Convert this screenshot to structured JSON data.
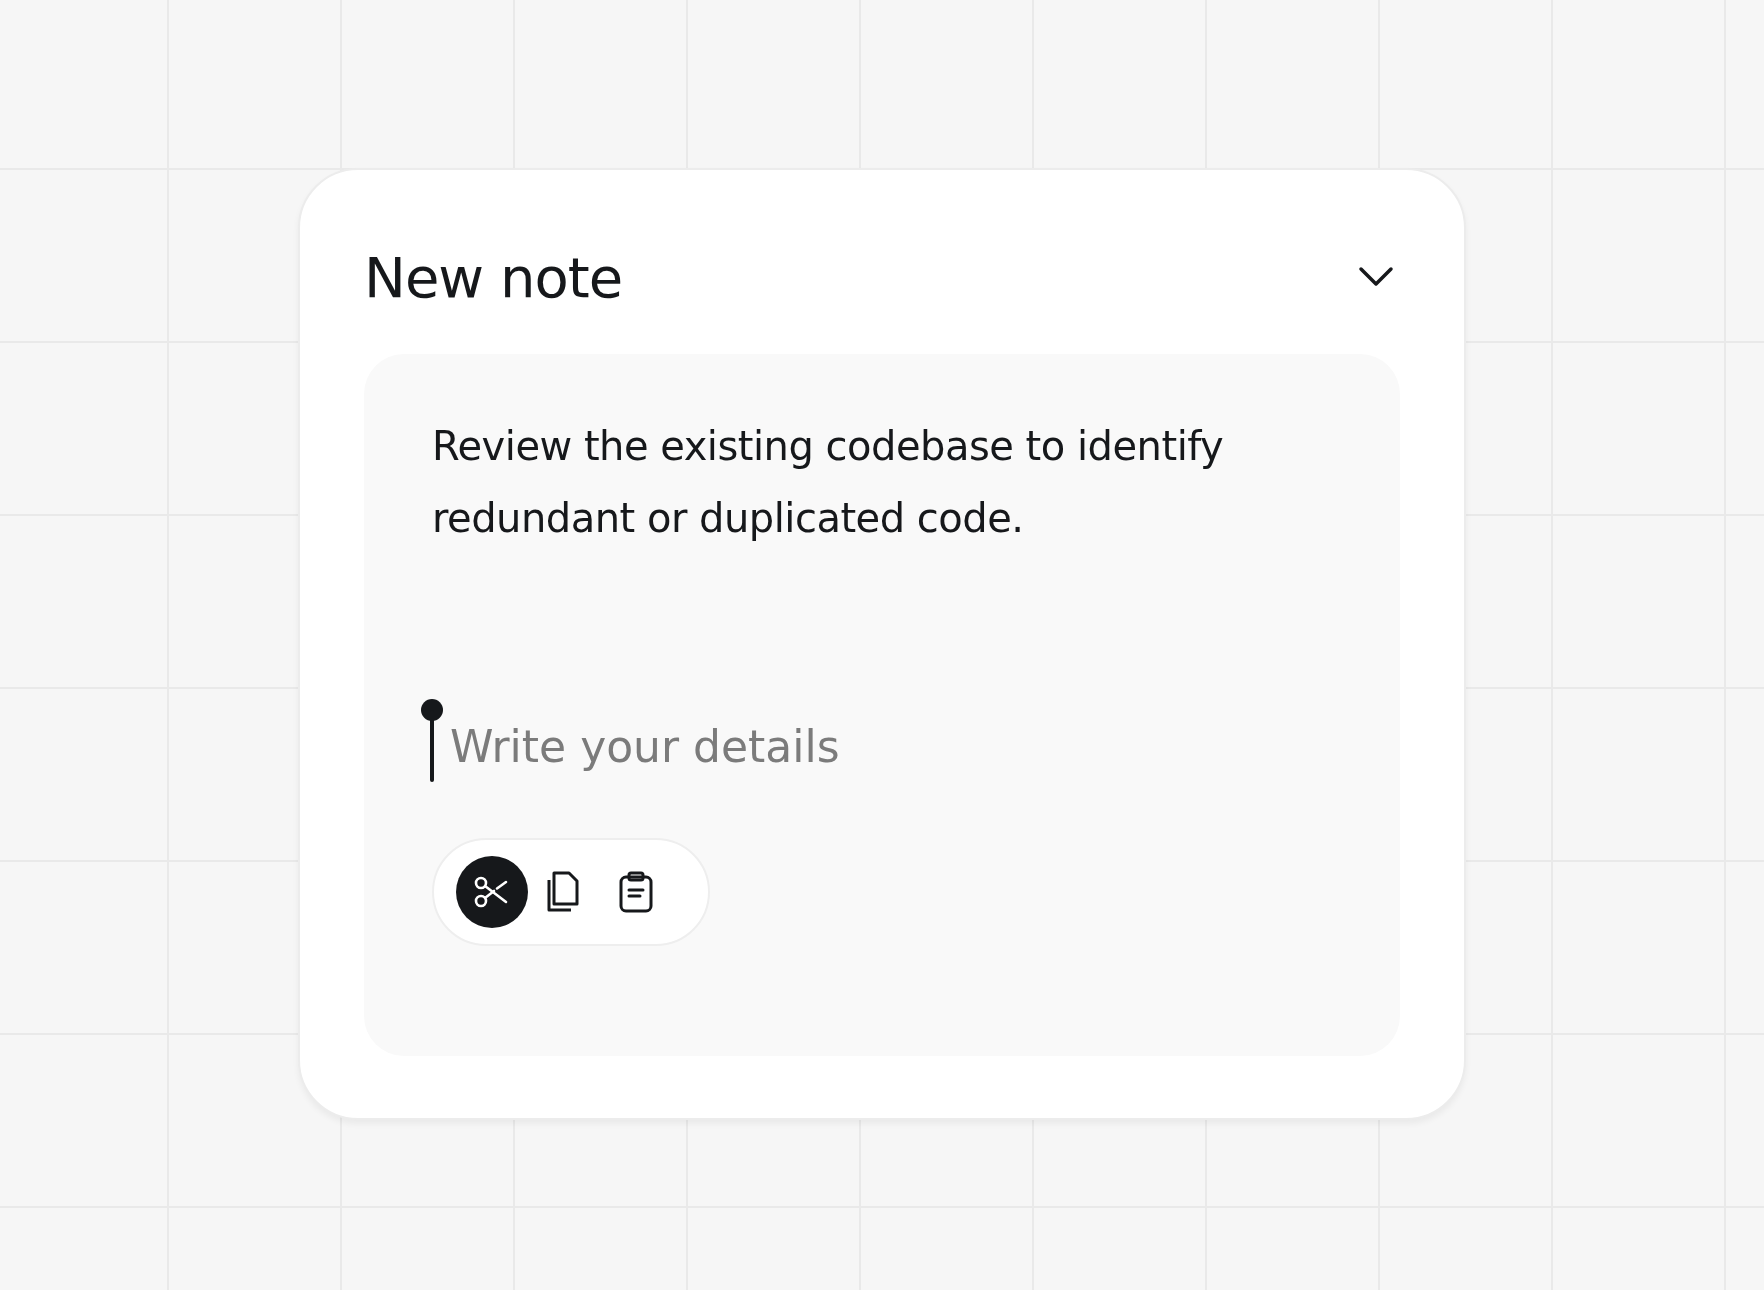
{
  "note": {
    "title": "New note",
    "text": "Review the existing codebase to identify redundant or duplicated code.",
    "details": {
      "placeholder": "Write your details"
    },
    "toolbar": [
      {
        "kind": "cut",
        "selected": true
      },
      {
        "kind": "copy",
        "selected": false
      },
      {
        "kind": "paste",
        "selected": false
      }
    ]
  }
}
